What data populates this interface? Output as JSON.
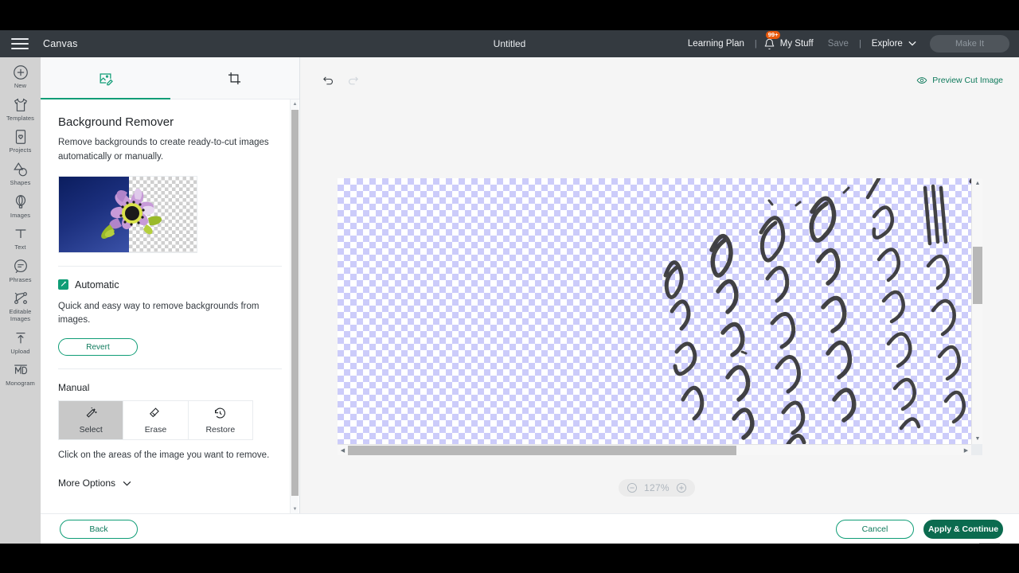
{
  "header": {
    "menu_icon": "hamburger-icon",
    "app_title": "Canvas",
    "doc_title": "Untitled",
    "learning_plan": "Learning Plan",
    "separator": "|",
    "notifications_badge": "99+",
    "bell_icon": "bell-icon",
    "my_stuff": "My Stuff",
    "save": "Save",
    "explore": "Explore",
    "chevron": "⌄",
    "make_it": "Make It"
  },
  "sidebar": {
    "items": [
      {
        "label": "New",
        "icon": "plus-circle-icon"
      },
      {
        "label": "Templates",
        "icon": "tshirt-icon"
      },
      {
        "label": "Projects",
        "icon": "card-heart-icon"
      },
      {
        "label": "Shapes",
        "icon": "shapes-icon"
      },
      {
        "label": "Images",
        "icon": "hot-air-balloon-icon"
      },
      {
        "label": "Text",
        "icon": "text-t-icon"
      },
      {
        "label": "Phrases",
        "icon": "speech-bubble-icon"
      },
      {
        "label": "Editable Images",
        "icon": "editable-image-icon"
      },
      {
        "label": "Upload",
        "icon": "upload-arrow-icon"
      },
      {
        "label": "Monogram",
        "icon": "monogram-icon"
      }
    ]
  },
  "panel": {
    "tabs": [
      {
        "name": "image-edit",
        "icon": "image-edit-icon",
        "active": true
      },
      {
        "name": "crop",
        "icon": "crop-icon",
        "active": false
      }
    ],
    "title": "Background Remover",
    "description": "Remove backgrounds to create ready-to-cut images automatically or manually.",
    "preview_alt": "flower-before-after-preview",
    "automatic": {
      "badge_icon": "auto-magic-badge-icon",
      "title": "Automatic",
      "description": "Quick and easy way to remove backgrounds from images.",
      "revert_label": "Revert"
    },
    "manual": {
      "label": "Manual",
      "tools": [
        {
          "label": "Select",
          "icon": "magic-wand-icon",
          "active": true
        },
        {
          "label": "Erase",
          "icon": "eraser-icon",
          "active": false
        },
        {
          "label": "Restore",
          "icon": "restore-clock-icon",
          "active": false
        }
      ],
      "hint": "Click on the areas of the image you want to remove."
    },
    "more_options": "More Options",
    "more_options_chevron": "⌄"
  },
  "canvas": {
    "undo_icon": "undo-arrow-icon",
    "redo_icon": "redo-arrow-icon",
    "preview_cut_icon": "eye-icon",
    "preview_cut_label": "Preview Cut Image",
    "zoom_out_icon": "minus-circle-icon",
    "zoom_in_icon": "plus-circle-icon",
    "zoom_level": "127%",
    "image_alt": "handwritten-recipe-rotated"
  },
  "footer": {
    "back": "Back",
    "cancel": "Cancel",
    "apply": "Apply & Continue"
  },
  "colors": {
    "accent_teal": "#0f9d76",
    "accent_dark_green": "#0b6b4f",
    "header_bg": "#343a40",
    "rail_bg": "#d2d2d2",
    "badge_orange": "#e8590c",
    "checker_lavender": "#ccccfa"
  }
}
